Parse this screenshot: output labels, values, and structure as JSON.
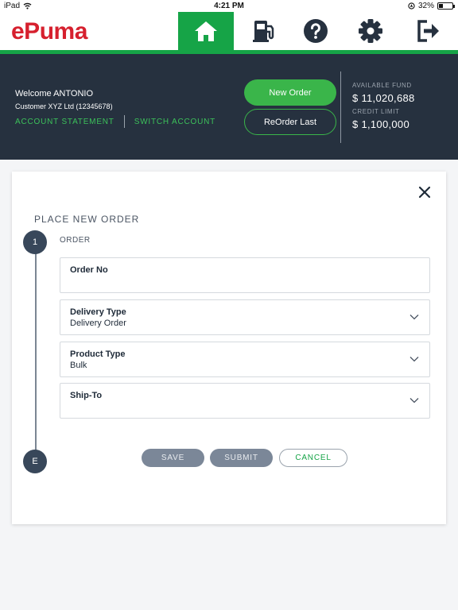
{
  "status_bar": {
    "device": "iPad",
    "time": "4:21 PM",
    "battery": "32%",
    "battery_level": 0.32
  },
  "header": {
    "logo": "ePuma",
    "nav": [
      {
        "icon": "home-icon",
        "active": true
      },
      {
        "icon": "fuel-pump-icon",
        "active": false
      },
      {
        "icon": "help-icon",
        "active": false
      },
      {
        "icon": "gear-icon",
        "active": false
      },
      {
        "icon": "logout-icon",
        "active": false
      }
    ]
  },
  "account": {
    "welcome": "Welcome ANTONIO",
    "customer": "Customer XYZ Ltd (12345678)",
    "account_statement": "ACCOUNT STATEMENT",
    "switch_account": "SWITCH ACCOUNT",
    "new_order": "New Order",
    "reorder_last": "ReOrder Last",
    "available_fund_label": "AVAILABLE FUND",
    "available_fund_value": "$ 11,020,688",
    "credit_limit_label": "CREDIT LIMIT",
    "credit_limit_value": "$ 1,100,000"
  },
  "order_form": {
    "title": "PLACE NEW ORDER",
    "step_1": "1",
    "step_end": "E",
    "section": "ORDER",
    "fields": [
      {
        "label": "Order No",
        "value": "",
        "dropdown": false
      },
      {
        "label": "Delivery Type",
        "value": "Delivery Order",
        "dropdown": true
      },
      {
        "label": "Product Type",
        "value": "Bulk",
        "dropdown": true
      },
      {
        "label": "Ship-To",
        "value": "",
        "dropdown": true
      }
    ],
    "save": "SAVE",
    "submit": "SUBMIT",
    "cancel": "CANCEL"
  },
  "colors": {
    "brand_red": "#d6202e",
    "brand_green": "#16a447",
    "dark_band": "#26313f"
  }
}
